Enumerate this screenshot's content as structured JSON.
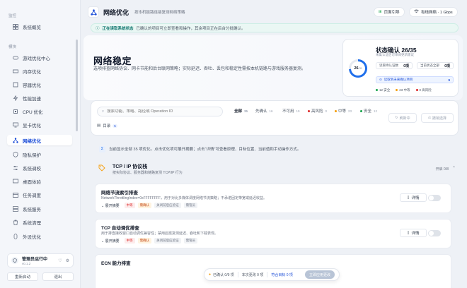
{
  "sidebar": {
    "section_monitor": "监控",
    "overview": "系统概览",
    "section_module": "模块",
    "items": [
      {
        "label": "游戏优化中心"
      },
      {
        "label": "内存优化"
      },
      {
        "label": "容器优化"
      },
      {
        "label": "性能加速"
      },
      {
        "label": "CPU 优化"
      },
      {
        "label": "显卡优化"
      },
      {
        "label": "网络优化"
      },
      {
        "label": "隐私保护"
      },
      {
        "label": "系统调校"
      },
      {
        "label": "桌面体验"
      },
      {
        "label": "任务调度"
      },
      {
        "label": "系统服务"
      },
      {
        "label": "系统清理"
      },
      {
        "label": "外设优化"
      }
    ],
    "admin_name": "管理员运行中",
    "admin_version": "v0.1.2",
    "restart_label": "重新启动",
    "exit_label": "退出"
  },
  "header": {
    "title": "网络优化",
    "subtitle": "按本机链路连接复测网络策略",
    "guide_label": "页面引导",
    "network_label": "有线网络 · 1 Gbps"
  },
  "banner": {
    "title": "正在读取系统状态",
    "text": "已确认的项目可立即查看和操作，其余项目正在后台分批确认。"
  },
  "hero": {
    "title": "网络稳定",
    "desc": "选项排查网络协议、网卡节能和后台联网策略；实际延迟、吞吐、丢包和稳定性需按本机链路与游戏服务器复测。"
  },
  "status_card": {
    "title": "状态确认  26/35",
    "subtitle": "采集认证后可审阅更新建议",
    "ring_value": "26",
    "ring_total": "/35",
    "ring_fraction": 0.74,
    "mini_left_label": "读取待认证数",
    "mini_left_value": "0项",
    "mini_right_label": "当前状态全部",
    "mini_right_value": "0项",
    "blue_label": "读取到未来确认项目",
    "blue_value": "9",
    "legend": [
      {
        "label": "12 安全",
        "color": "#16a34a"
      },
      {
        "label": "23 中等",
        "color": "#f59e0b"
      },
      {
        "label": "0 高风险",
        "color": "#dc2626"
      }
    ]
  },
  "filter": {
    "search_placeholder": "搜索功能、策略、路径或 Operation ID",
    "chips": [
      {
        "label": "全部",
        "count": "35"
      },
      {
        "label": "先确认",
        "count": "16"
      },
      {
        "label": "不可用",
        "count": "19"
      },
      {
        "label": "高风险",
        "count": "0"
      },
      {
        "label": "中等",
        "count": "23"
      },
      {
        "label": "安全",
        "count": "12"
      }
    ],
    "tag_label": "目录",
    "tag_count": "5",
    "refresh_label": "刷新中",
    "clear_label": "撤销选择"
  },
  "info_text": "当前显示全部 35 项优化。点击优化项可展开摘要；点击“详情”可查看原理、目标位置、当前值和手动操作方式。",
  "group": {
    "title": "TCP / IP 协议栈",
    "subtitle": "按实际协议、服务器和链路复测 TCP/IP 行为",
    "count": "开启 0/8"
  },
  "items": [
    {
      "title": "网络节流索引排查",
      "desc": "NetworkThrottlingIndex=0xFFFFFFFF，用于对比多媒体调度网络节流策略；不承诺固定带宽或延迟收益。",
      "expand": "展开摘要",
      "tags": [
        "中等",
        "需确认",
        "关闭前后应验证",
        "需管员"
      ],
      "detail": "详情"
    },
    {
      "title": "TCP 自动调优排查",
      "desc": "用于排查接收窗口自动调优兼容性；禁用后需复测延迟、吞吐和下载表现。",
      "expand": "展开摘要",
      "tags": [
        "中等",
        "需确认",
        "关闭前后应验证",
        "需管员"
      ],
      "detail": "详情"
    },
    {
      "title": "ECN 能力排查"
    }
  ],
  "bottombar": {
    "confirmed": "已确认 0/9 项",
    "changes": "本次更改 0 项",
    "target": "符合目标 0 项",
    "apply": "立即应用更改"
  }
}
